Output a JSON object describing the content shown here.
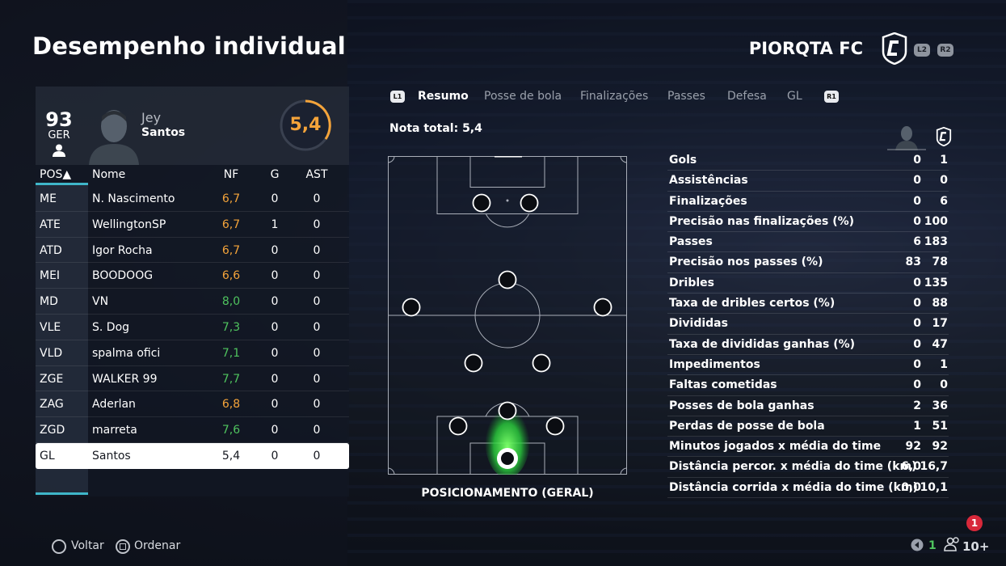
{
  "page": {
    "title": "Desempenho individual",
    "team_name": "PIORQTA FC",
    "team_buttons": [
      "L2",
      "R2"
    ]
  },
  "player": {
    "overall": "93",
    "position": "GER",
    "first_name": "Jey",
    "last_name": "Santos",
    "rating": "5,4"
  },
  "table": {
    "headers": {
      "pos": "POS▲",
      "name": "Nome",
      "nf": "NF",
      "g": "G",
      "ast": "AST"
    },
    "rows": [
      {
        "pos": "ME",
        "name": "N. Nascimento",
        "nf": "6,7",
        "g": "0",
        "ast": "0",
        "color": "#f5a43a"
      },
      {
        "pos": "ATE",
        "name": "WellingtonSP",
        "nf": "6,7",
        "g": "1",
        "ast": "0",
        "color": "#f5a43a"
      },
      {
        "pos": "ATD",
        "name": "Igor Rocha",
        "nf": "6,7",
        "g": "0",
        "ast": "0",
        "color": "#f5a43a"
      },
      {
        "pos": "MEI",
        "name": "BOODOOG",
        "nf": "6,6",
        "g": "0",
        "ast": "0",
        "color": "#f5a43a"
      },
      {
        "pos": "MD",
        "name": "VN",
        "nf": "8,0",
        "g": "0",
        "ast": "0",
        "color": "#4fc35e"
      },
      {
        "pos": "VLE",
        "name": "S. Dog",
        "nf": "7,3",
        "g": "0",
        "ast": "0",
        "color": "#4fc35e"
      },
      {
        "pos": "VLD",
        "name": "spalma ofici",
        "nf": "7,1",
        "g": "0",
        "ast": "0",
        "color": "#4fc35e"
      },
      {
        "pos": "ZGE",
        "name": "WALKER 99",
        "nf": "7,7",
        "g": "0",
        "ast": "0",
        "color": "#4fc35e"
      },
      {
        "pos": "ZAG",
        "name": "Aderlan",
        "nf": "6,8",
        "g": "0",
        "ast": "0",
        "color": "#f5a43a"
      },
      {
        "pos": "ZGD",
        "name": "marreta",
        "nf": "7,6",
        "g": "0",
        "ast": "0",
        "color": "#4fc35e"
      },
      {
        "pos": "GL",
        "name": "Santos",
        "nf": "5,4",
        "g": "0",
        "ast": "0",
        "color": "#151820"
      }
    ]
  },
  "tabs": {
    "left_button": "L1",
    "right_button": "R1",
    "items": [
      "Resumo",
      "Posse de bola",
      "Finalizações",
      "Passes",
      "Defesa",
      "GL"
    ]
  },
  "summary": {
    "total_label": "Nota total: 5,4"
  },
  "pitch": {
    "label": "POSICIONAMENTO (GERAL)"
  },
  "stats": [
    {
      "label": "Gols",
      "player": "0",
      "team": "1"
    },
    {
      "label": "Assistências",
      "player": "0",
      "team": "0"
    },
    {
      "label": "Finalizações",
      "player": "0",
      "team": "6"
    },
    {
      "label": "Precisão nas finalizações (%)",
      "player": "0",
      "team": "100"
    },
    {
      "label": "Passes",
      "player": "6",
      "team": "183"
    },
    {
      "label": "Precisão nos passes (%)",
      "player": "83",
      "team": "78"
    },
    {
      "label": "Dribles",
      "player": "0",
      "team": "135"
    },
    {
      "label": "Taxa de dribles certos (%)",
      "player": "0",
      "team": "88"
    },
    {
      "label": "Divididas",
      "player": "0",
      "team": "17"
    },
    {
      "label": "Taxa de divididas ganhas (%)",
      "player": "0",
      "team": "47"
    },
    {
      "label": "Impedimentos",
      "player": "0",
      "team": "1"
    },
    {
      "label": "Faltas cometidas",
      "player": "0",
      "team": "0"
    },
    {
      "label": "Posses de bola ganhas",
      "player": "2",
      "team": "36"
    },
    {
      "label": "Perdas de posse de bola",
      "player": "1",
      "team": "51"
    },
    {
      "label": "Minutos jogados x média do time",
      "player": "92",
      "team": "92"
    },
    {
      "label": "Distância percor. x média do time (km)",
      "player": "6,0",
      "team": "16,7"
    },
    {
      "label": "Distância corrida x média do time (km)",
      "player": "0,0",
      "team": "10,1"
    }
  ],
  "footer": {
    "back": "Voltar",
    "sort": "Ordenar",
    "notifications": "1",
    "friends_online": "1",
    "party": "10+"
  },
  "colors": {
    "accent": "#3fb6c9",
    "orange": "#f5a43a",
    "green": "#4fc35e"
  }
}
